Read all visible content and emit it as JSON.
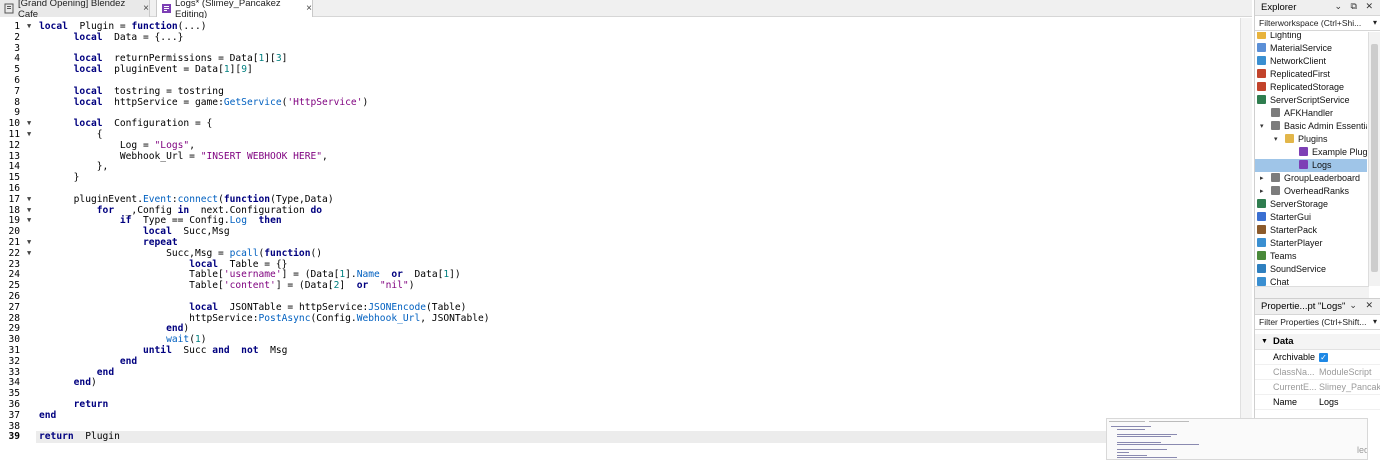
{
  "tabs": [
    {
      "label": "[Grand Opening] Blendez Cafe",
      "close": "×"
    },
    {
      "label": "Logs* (Slimey_Pancakez Editing)",
      "close": "×"
    }
  ],
  "editor": {
    "current_line": 39,
    "lines": [
      {
        "n": "1",
        "fold": "▼"
      },
      {
        "n": "2",
        "fold": ""
      },
      {
        "n": "3",
        "fold": ""
      },
      {
        "n": "4",
        "fold": ""
      },
      {
        "n": "5",
        "fold": ""
      },
      {
        "n": "6",
        "fold": ""
      },
      {
        "n": "7",
        "fold": ""
      },
      {
        "n": "8",
        "fold": ""
      },
      {
        "n": "9",
        "fold": ""
      },
      {
        "n": "10",
        "fold": "▼"
      },
      {
        "n": "11",
        "fold": "▼"
      },
      {
        "n": "12",
        "fold": ""
      },
      {
        "n": "13",
        "fold": ""
      },
      {
        "n": "14",
        "fold": ""
      },
      {
        "n": "15",
        "fold": ""
      },
      {
        "n": "16",
        "fold": ""
      },
      {
        "n": "17",
        "fold": "▼"
      },
      {
        "n": "18",
        "fold": "▼"
      },
      {
        "n": "19",
        "fold": "▼"
      },
      {
        "n": "20",
        "fold": ""
      },
      {
        "n": "21",
        "fold": "▼"
      },
      {
        "n": "22",
        "fold": "▼"
      },
      {
        "n": "23",
        "fold": ""
      },
      {
        "n": "24",
        "fold": ""
      },
      {
        "n": "25",
        "fold": ""
      },
      {
        "n": "26",
        "fold": ""
      },
      {
        "n": "27",
        "fold": ""
      },
      {
        "n": "28",
        "fold": ""
      },
      {
        "n": "29",
        "fold": ""
      },
      {
        "n": "30",
        "fold": ""
      },
      {
        "n": "31",
        "fold": ""
      },
      {
        "n": "32",
        "fold": ""
      },
      {
        "n": "33",
        "fold": ""
      },
      {
        "n": "34",
        "fold": ""
      },
      {
        "n": "35",
        "fold": ""
      },
      {
        "n": "36",
        "fold": ""
      },
      {
        "n": "37",
        "fold": ""
      },
      {
        "n": "38",
        "fold": ""
      },
      {
        "n": "39",
        "fold": ""
      }
    ],
    "code": [
      [
        [
          "kw",
          "local"
        ],
        [
          "",
          "  Plugin = "
        ],
        [
          "kw",
          "function"
        ],
        [
          "",
          "(...)"
        ]
      ],
      [
        [
          "",
          "      "
        ],
        [
          "kw",
          "local"
        ],
        [
          "",
          "  Data = {...}"
        ]
      ],
      [],
      [
        [
          "",
          "      "
        ],
        [
          "kw",
          "local"
        ],
        [
          "",
          "  returnPermissions = Data["
        ],
        [
          "num",
          "1"
        ],
        [
          "",
          "]["
        ],
        [
          "num",
          "3"
        ],
        [
          "",
          "]"
        ]
      ],
      [
        [
          "",
          "      "
        ],
        [
          "kw",
          "local"
        ],
        [
          "",
          "  pluginEvent = Data["
        ],
        [
          "num",
          "1"
        ],
        [
          "",
          "]["
        ],
        [
          "num",
          "9"
        ],
        [
          "",
          "]"
        ]
      ],
      [],
      [
        [
          "",
          "      "
        ],
        [
          "kw",
          "local"
        ],
        [
          "",
          "  tostring = tostring"
        ]
      ],
      [
        [
          "",
          "      "
        ],
        [
          "kw",
          "local"
        ],
        [
          "",
          "  httpService = game:"
        ],
        [
          "mth",
          "GetService"
        ],
        [
          "",
          "("
        ],
        [
          "str",
          "'HttpService'"
        ],
        [
          "",
          ")"
        ]
      ],
      [],
      [
        [
          "",
          "      "
        ],
        [
          "kw",
          "local"
        ],
        [
          "",
          "  Configuration = {"
        ]
      ],
      [
        [
          "",
          "          {"
        ]
      ],
      [
        [
          "",
          "              Log = "
        ],
        [
          "str",
          "\"Logs\""
        ],
        [
          "",
          ","
        ]
      ],
      [
        [
          "",
          "              Webhook_Url = "
        ],
        [
          "str",
          "\"INSERT WEBHOOK HERE\""
        ],
        [
          "",
          ","
        ]
      ],
      [
        [
          "",
          "          },"
        ]
      ],
      [
        [
          "",
          "      }"
        ]
      ],
      [],
      [
        [
          "",
          "      pluginEvent."
        ],
        [
          "mth",
          "Event"
        ],
        [
          "",
          ":"
        ],
        [
          "mth",
          "connect"
        ],
        [
          "",
          "("
        ],
        [
          "kw",
          "function"
        ],
        [
          "",
          "(Type,Data)"
        ]
      ],
      [
        [
          "",
          "          "
        ],
        [
          "kw",
          "for"
        ],
        [
          "",
          "  _,Config "
        ],
        [
          "kw",
          "in"
        ],
        [
          "",
          "  next.Configuration "
        ],
        [
          "kw",
          "do"
        ]
      ],
      [
        [
          "",
          "              "
        ],
        [
          "kw",
          "if"
        ],
        [
          "",
          "  Type == Config."
        ],
        [
          "mth",
          "Log"
        ],
        [
          "",
          ""
        ],
        [
          "kw",
          "  then"
        ]
      ],
      [
        [
          "",
          "                  "
        ],
        [
          "kw",
          "local"
        ],
        [
          "",
          "  Succ,Msg"
        ]
      ],
      [
        [
          "",
          "                  "
        ],
        [
          "kw",
          "repeat"
        ]
      ],
      [
        [
          "",
          "                      Succ,Msg = "
        ],
        [
          "mth",
          "pcall"
        ],
        [
          "",
          "("
        ],
        [
          "kw",
          "function"
        ],
        [
          "",
          "()"
        ]
      ],
      [
        [
          "",
          "                          "
        ],
        [
          "kw",
          "local"
        ],
        [
          "",
          "  Table = {}"
        ]
      ],
      [
        [
          "",
          "                          Table["
        ],
        [
          "str",
          "'username'"
        ],
        [
          "",
          "] = (Data["
        ],
        [
          "num",
          "1"
        ],
        [
          "",
          "]."
        ],
        [
          "mth",
          "Name"
        ],
        [
          "",
          ""
        ],
        [
          "kw",
          "  or"
        ],
        [
          "",
          "  Data["
        ],
        [
          "num",
          "1"
        ],
        [
          "",
          "])"
        ]
      ],
      [
        [
          "",
          "                          Table["
        ],
        [
          "str",
          "'content'"
        ],
        [
          "",
          "] = (Data["
        ],
        [
          "num",
          "2"
        ],
        [
          "",
          "]"
        ],
        [
          "kw",
          "  or"
        ],
        [
          "",
          "  "
        ],
        [
          "str",
          "\"nil\""
        ],
        [
          "",
          ")"
        ]
      ],
      [],
      [
        [
          "",
          "                          "
        ],
        [
          "kw",
          "local"
        ],
        [
          "",
          "  JSONTable = httpService:"
        ],
        [
          "mth",
          "JSONEncode"
        ],
        [
          "",
          "(Table)"
        ]
      ],
      [
        [
          "",
          "                          httpService:"
        ],
        [
          "mth",
          "PostAsync"
        ],
        [
          "",
          "(Config."
        ],
        [
          "mth",
          "Webhook_Url"
        ],
        [
          "",
          ", JSONTable)"
        ]
      ],
      [
        [
          "",
          "                      "
        ],
        [
          "kw",
          "end"
        ],
        [
          "",
          ")"
        ]
      ],
      [
        [
          "",
          "                      "
        ],
        [
          "mth",
          "wait"
        ],
        [
          "",
          "("
        ],
        [
          "num",
          "1"
        ],
        [
          "",
          ")"
        ]
      ],
      [
        [
          "",
          "                  "
        ],
        [
          "kw",
          "until"
        ],
        [
          "",
          "  Succ "
        ],
        [
          "kw",
          "and"
        ],
        [
          "",
          ""
        ],
        [
          "kw",
          "  not"
        ],
        [
          "",
          "  Msg"
        ]
      ],
      [
        [
          "",
          "              "
        ],
        [
          "kw",
          "end"
        ]
      ],
      [
        [
          "",
          "          "
        ],
        [
          "kw",
          "end"
        ]
      ],
      [
        [
          "",
          "      "
        ],
        [
          "kw",
          "end"
        ],
        [
          "",
          ")"
        ]
      ],
      [],
      [
        [
          "",
          "      "
        ],
        [
          "kw",
          "return"
        ]
      ],
      [
        [
          "kw",
          "end"
        ]
      ],
      [],
      [
        [
          "kw",
          "return"
        ],
        [
          "",
          "  Plugin"
        ]
      ]
    ]
  },
  "explorer": {
    "title": "Explorer",
    "controls": "⌄ ⧉ ✕",
    "filter_placeholder": "Filterworkspace (Ctrl+Shi...",
    "items": [
      {
        "label": "Lighting",
        "depth": 0,
        "icon": "lighting-icon",
        "color": "#e8b33c"
      },
      {
        "label": "MaterialService",
        "depth": 0,
        "icon": "material-service-icon",
        "color": "#5b8fd6"
      },
      {
        "label": "NetworkClient",
        "depth": 0,
        "icon": "network-client-icon",
        "color": "#3a8fd1"
      },
      {
        "label": "ReplicatedFirst",
        "depth": 0,
        "icon": "replicated-first-icon",
        "color": "#c2432b"
      },
      {
        "label": "ReplicatedStorage",
        "depth": 0,
        "icon": "replicated-storage-icon",
        "color": "#c2432b"
      },
      {
        "label": "ServerScriptService",
        "depth": 0,
        "icon": "server-script-service-icon",
        "color": "#2f7d4f"
      },
      {
        "label": "AFKHandler",
        "depth": 1,
        "icon": "script-icon",
        "color": "#7c7c7c"
      },
      {
        "label": "Basic Admin Essentials",
        "depth": 1,
        "icon": "script-icon",
        "color": "#7c7c7c",
        "arrow": "▾"
      },
      {
        "label": "Plugins",
        "depth": 2,
        "icon": "folder-icon",
        "color": "#e2b64a",
        "arrow": "▾"
      },
      {
        "label": "Example Plugin",
        "depth": 3,
        "icon": "module-script-icon",
        "color": "#7d3fb5"
      },
      {
        "label": "Logs",
        "depth": 3,
        "icon": "module-script-icon",
        "color": "#7d3fb5",
        "selected": true
      },
      {
        "label": "GroupLeaderboard",
        "depth": 1,
        "icon": "script-icon",
        "color": "#7c7c7c",
        "arrow": "▸"
      },
      {
        "label": "OverheadRanks",
        "depth": 1,
        "icon": "script-icon",
        "color": "#7c7c7c",
        "arrow": "▸"
      },
      {
        "label": "ServerStorage",
        "depth": 0,
        "icon": "server-storage-icon",
        "color": "#2f7d4f"
      },
      {
        "label": "StarterGui",
        "depth": 0,
        "icon": "starter-gui-icon",
        "color": "#3a6fd1"
      },
      {
        "label": "StarterPack",
        "depth": 0,
        "icon": "starter-pack-icon",
        "color": "#8b5a2b"
      },
      {
        "label": "StarterPlayer",
        "depth": 0,
        "icon": "starter-player-icon",
        "color": "#3a8fd1"
      },
      {
        "label": "Teams",
        "depth": 0,
        "icon": "teams-icon",
        "color": "#4a8a3a"
      },
      {
        "label": "SoundService",
        "depth": 0,
        "icon": "sound-service-icon",
        "color": "#2e7fbf"
      },
      {
        "label": "Chat",
        "depth": 0,
        "icon": "chat-icon",
        "color": "#3a8fd1"
      }
    ]
  },
  "properties": {
    "title": "Propertie...pt \"Logs\"",
    "controls": "⌄ ✕",
    "filter_placeholder": "Filter Properties (Ctrl+Shift...",
    "section": "Data",
    "rows": [
      {
        "key": "Archivable",
        "value": "",
        "checkbox": true,
        "dim": false
      },
      {
        "key": "ClassNa...",
        "value": "ModuleScript",
        "checkbox": false,
        "dim": true
      },
      {
        "key": "CurrentE...",
        "value": "Slimey_Pancake",
        "checkbox": false,
        "dim": true
      },
      {
        "key": "Name",
        "value": "Logs",
        "checkbox": false,
        "dim": false
      }
    ]
  },
  "minimap": {
    "faded_text": "led"
  }
}
